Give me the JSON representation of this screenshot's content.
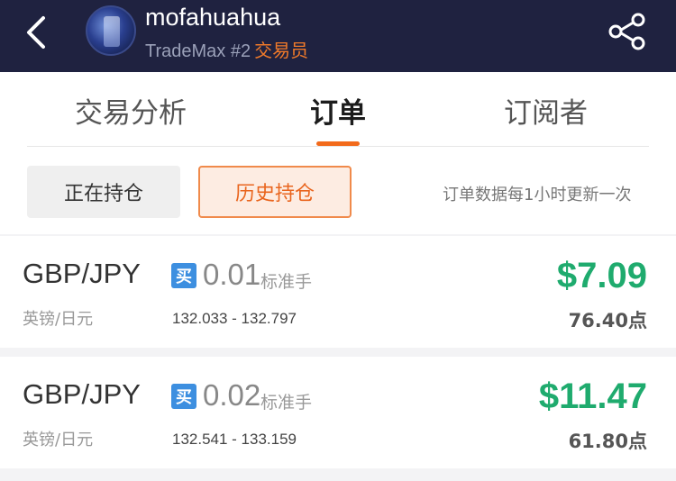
{
  "header": {
    "username": "mofahuahua",
    "rank": "TradeMax #2",
    "role": "交易员",
    "back_icon": "chevron-left-icon",
    "share_icon": "share-icon"
  },
  "tabs": [
    {
      "label": "交易分析",
      "active": false
    },
    {
      "label": "订单",
      "active": true
    },
    {
      "label": "订阅者",
      "active": false
    }
  ],
  "segments": {
    "open_label": "正在持仓",
    "history_label": "历史持仓",
    "active": "history",
    "note": "订单数据每1小时更新一次"
  },
  "orders": [
    {
      "pair": "GBP/JPY",
      "pair_cn": "英镑/日元",
      "side": "买",
      "lots": "0.01",
      "lot_unit": "标准手",
      "price_range": "132.033 - 132.797",
      "profit": "$7.09",
      "points": "76.40点"
    },
    {
      "pair": "GBP/JPY",
      "pair_cn": "英镑/日元",
      "side": "买",
      "lots": "0.02",
      "lot_unit": "标准手",
      "price_range": "132.541 - 133.159",
      "profit": "$11.47",
      "points": "61.80点"
    }
  ],
  "colors": {
    "header_bg": "#1f2240",
    "accent_orange": "#f26a1b",
    "profit_green": "#1fab6e",
    "buy_blue": "#3d8fe0"
  }
}
